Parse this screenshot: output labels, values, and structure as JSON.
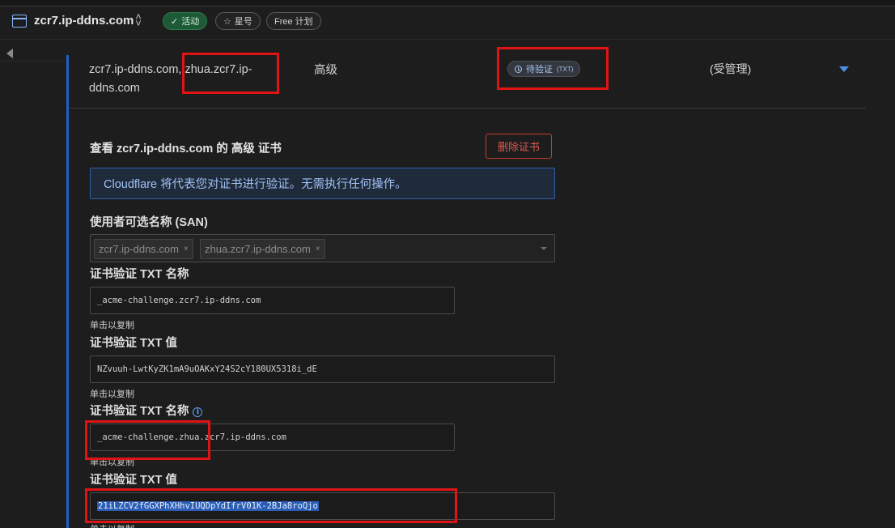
{
  "header": {
    "zone_name": "zcr7.ip-ddns.com",
    "updown_icon": "⌃⌄",
    "status_pill": "活动",
    "star_pill": "星号",
    "plan_pill": "Free 计划"
  },
  "row": {
    "domains": "zcr7.ip-ddns.com, zhua.zcr7.ip-ddns.com",
    "type": "高级",
    "status": "待验证",
    "status_sub": "(TXT)",
    "managed": "(受管理)"
  },
  "detail": {
    "title": "查看 zcr7.ip-ddns.com 的 高级 证书",
    "delete_label": "删除证书",
    "info_message": "Cloudflare 将代表您对证书进行验证。无需执行任何操作。",
    "san_label": "使用者可选名称 (SAN)",
    "san_items": [
      "zcr7.ip-ddns.com",
      "zhua.zcr7.ip-ddns.com"
    ],
    "chip_remove": "×",
    "copy_hint": "单击以复制",
    "txt_blocks": [
      {
        "name_label": "证书验证 TXT 名称",
        "name_value": "_acme-challenge.zcr7.ip-ddns.com",
        "value_label": "证书验证 TXT 值",
        "value_value": "NZvuuh-LwtKyZK1mA9uOAKxY24S2cY180UX5318i_dE"
      },
      {
        "name_label": "证书验证 TXT 名称",
        "name_value": "_acme-challenge.zhua.zcr7.ip-ddns.com",
        "value_label": "证书验证 TXT 值",
        "value_value": "21iLZCV2fGGXPhXHhvIUQDpYdIfrV01K-2BJa8roQjo"
      }
    ]
  },
  "colors": {
    "accent": "#1f5fc9",
    "annotation": "#e01414",
    "danger": "#c53a32",
    "active_green": "#1f5a36"
  }
}
